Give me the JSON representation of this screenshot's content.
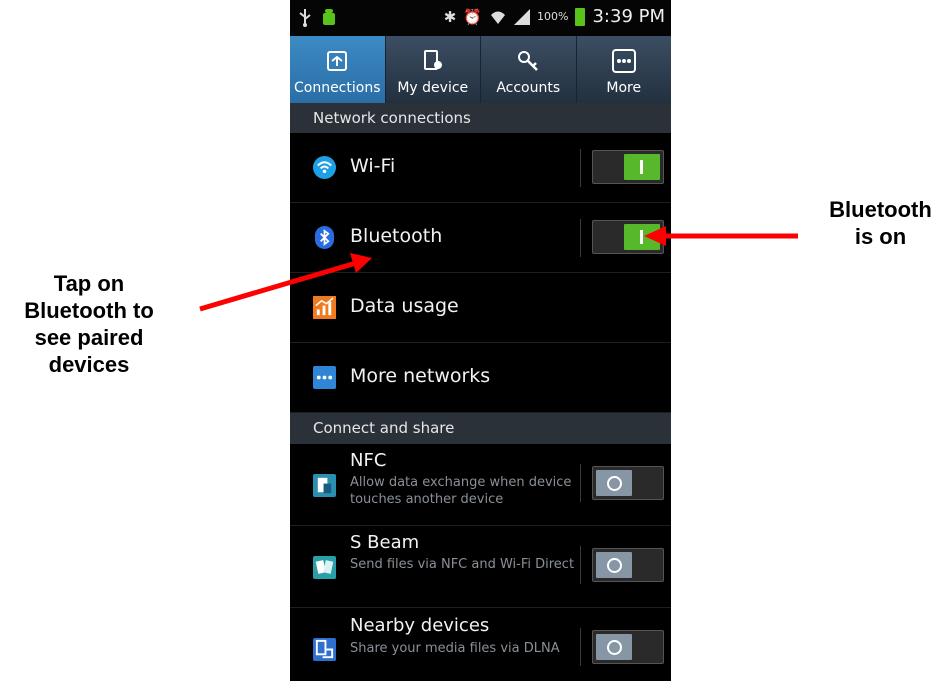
{
  "status_bar": {
    "battery_percent": "100%",
    "time": "3:39 PM"
  },
  "tabs": [
    {
      "label": "Connections",
      "icon": "connections-icon",
      "active": true
    },
    {
      "label": "My device",
      "icon": "my-device-icon",
      "active": false
    },
    {
      "label": "Accounts",
      "icon": "accounts-icon",
      "active": false
    },
    {
      "label": "More",
      "icon": "more-icon",
      "active": false
    }
  ],
  "sections": {
    "network": "Network connections",
    "share": "Connect and share"
  },
  "rows": {
    "wifi": {
      "title": "Wi-Fi",
      "icon": "wifi-icon",
      "toggle": "on"
    },
    "bluetooth": {
      "title": "Bluetooth",
      "icon": "bluetooth-icon",
      "toggle": "on"
    },
    "data_usage": {
      "title": "Data usage",
      "icon": "data-usage-icon"
    },
    "more_networks": {
      "title": "More networks",
      "icon": "more-networks-icon"
    },
    "nfc": {
      "title": "NFC",
      "subtitle": "Allow data exchange when device touches another device",
      "icon": "nfc-icon",
      "toggle": "off"
    },
    "s_beam": {
      "title": "S Beam",
      "subtitle": "Send files via NFC and Wi-Fi Direct",
      "icon": "s-beam-icon",
      "toggle": "off"
    },
    "nearby": {
      "title": "Nearby devices",
      "subtitle": "Share your media files via DLNA",
      "icon": "nearby-devices-icon",
      "toggle": "off"
    }
  },
  "annotations": {
    "right_line1": "Bluetooth",
    "right_line2": "is on",
    "left_line1": "Tap on",
    "left_line2": "Bluetooth to",
    "left_line3": "see paired",
    "left_line4": "devices"
  },
  "colors": {
    "accent_tab": "#3584c0",
    "toggle_on": "#58b82c",
    "arrow": "#ff0000"
  }
}
